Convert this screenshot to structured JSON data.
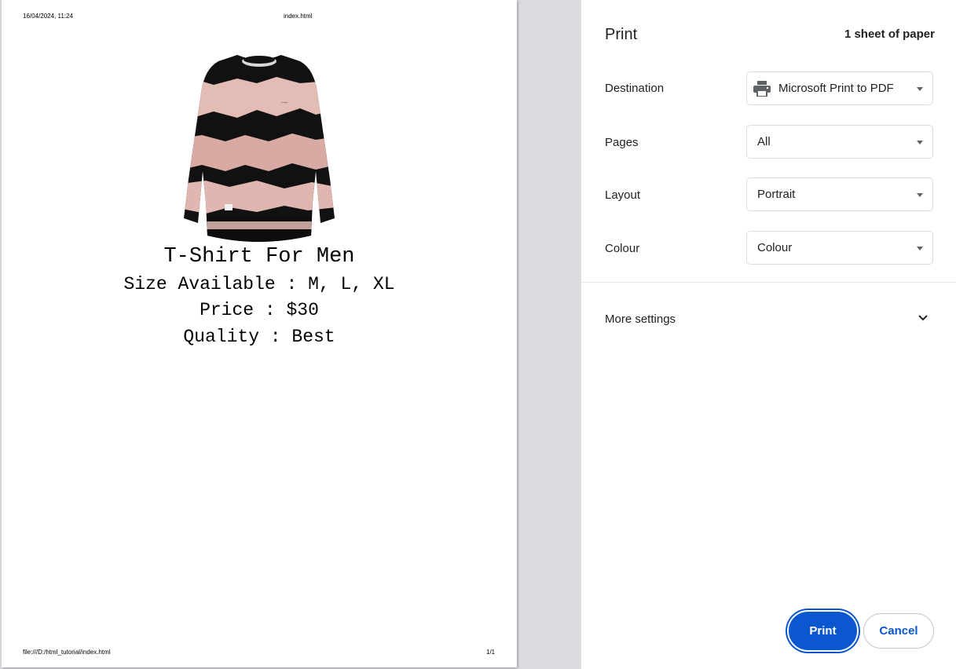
{
  "preview": {
    "header_date": "16/04/2024, 11:24",
    "header_title": "index.html",
    "footer_url": "file:///D:/html_tutorial/index.html",
    "footer_page": "1/1",
    "product": {
      "image_icon": "sweatshirt-image",
      "name": "T-Shirt For Men",
      "size": "Size Available : M, L, XL",
      "price": "Price : $30",
      "quality": "Quality : Best"
    }
  },
  "settings": {
    "title": "Print",
    "sheet_count": "1 sheet of paper",
    "destination": {
      "label": "Destination",
      "value": "Microsoft Print to PDF",
      "icon": "printer-icon"
    },
    "pages": {
      "label": "Pages",
      "value": "All"
    },
    "layout": {
      "label": "Layout",
      "value": "Portrait"
    },
    "colour": {
      "label": "Colour",
      "value": "Colour"
    },
    "more_settings": {
      "label": "More settings",
      "icon": "chevron-down-icon"
    },
    "print_button": "Print",
    "cancel_button": "Cancel"
  },
  "colors": {
    "accent": "#0b57d0",
    "preview_bg": "#dadce0",
    "text": "#202124"
  }
}
